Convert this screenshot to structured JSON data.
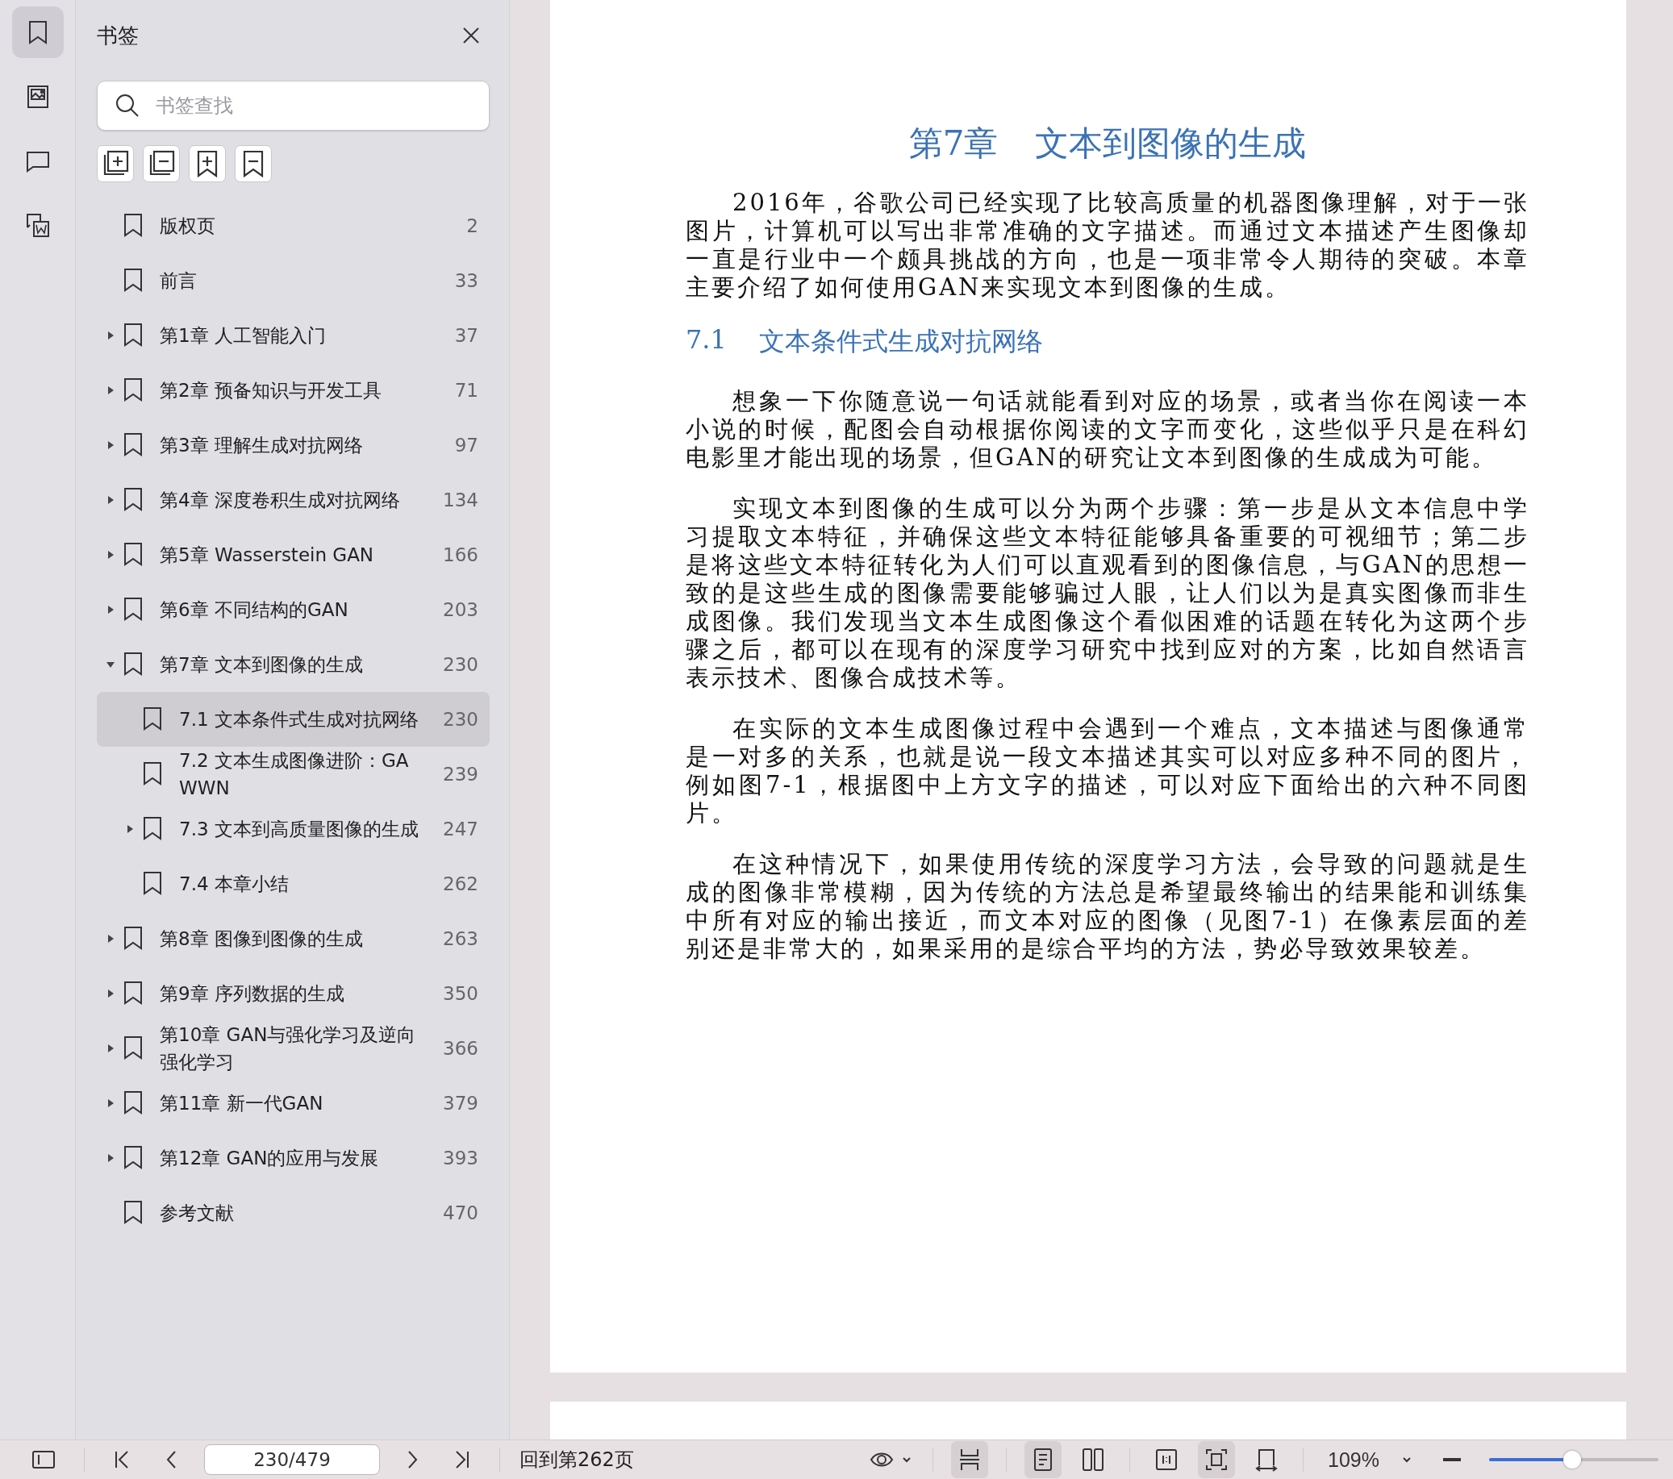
{
  "rail": [
    {
      "kind": "bookmarks",
      "selected": true
    },
    {
      "kind": "images",
      "selected": false
    },
    {
      "kind": "comments",
      "selected": false
    },
    {
      "kind": "convert",
      "selected": false
    }
  ],
  "sidebar": {
    "title": "书签",
    "search": {
      "placeholder": "书签查找"
    },
    "tools": [
      {
        "kind": "expand-all"
      },
      {
        "kind": "collapse-all"
      },
      {
        "kind": "add"
      },
      {
        "kind": "remove"
      }
    ],
    "items": [
      {
        "label": "版权页",
        "page": "2",
        "selected": false
      },
      {
        "label": "前言",
        "page": "33",
        "selected": false
      },
      {
        "label": "第1章 人工智能入门",
        "page": "37",
        "selected": false,
        "expanded": false
      },
      {
        "label": "第2章 预备知识与开发工具",
        "page": "71",
        "selected": false,
        "expanded": false
      },
      {
        "label": "第3章 理解生成对抗网络",
        "page": "97",
        "selected": false,
        "expanded": false
      },
      {
        "label": "第4章 深度卷积生成对抗网络",
        "page": "134",
        "selected": false,
        "expanded": false
      },
      {
        "label": "第5章 Wasserstein GAN",
        "page": "166",
        "selected": false,
        "expanded": false
      },
      {
        "label": "第6章 不同结构的GAN",
        "page": "203",
        "selected": false,
        "expanded": false
      },
      {
        "label": "第7章 文本到图像的生成",
        "page": "230",
        "selected": false,
        "expanded": true,
        "children": [
          {
            "label": "7.1 文本条件式生成对抗网络",
            "page": "230",
            "selected": true
          },
          {
            "label": "7.2 文本生成图像进阶：GAWWN",
            "page": "239",
            "selected": false
          },
          {
            "label": "7.3 文本到高质量图像的生成",
            "page": "247",
            "selected": false,
            "expanded": false
          },
          {
            "label": "7.4 本章小结",
            "page": "262",
            "selected": false
          }
        ]
      },
      {
        "label": "第8章 图像到图像的生成",
        "page": "263",
        "selected": false,
        "expanded": false
      },
      {
        "label": "第9章 序列数据的生成",
        "page": "350",
        "selected": false,
        "expanded": false
      },
      {
        "label": "第10章 GAN与强化学习及逆向强化学习",
        "page": "366",
        "selected": false,
        "expanded": false
      },
      {
        "label": "第11章 新一代GAN",
        "page": "379",
        "selected": false,
        "expanded": false
      },
      {
        "label": "第12章 GAN的应用与发展",
        "page": "393",
        "selected": false,
        "expanded": false
      },
      {
        "label": "参考文献",
        "page": "470",
        "selected": false
      }
    ]
  },
  "document": {
    "chapter_number": "第7章",
    "chapter_title": "文本到图像的生成",
    "blocks": [
      {
        "kind": "paragraph",
        "text": "2016年，谷歌公司已经实现了比较高质量的机器图像理解，对于一张图片，计算机可以写出非常准确的文字描述。而通过文本描述产生图像却一直是行业中一个颇具挑战的方向，也是一项非常令人期待的突破。本章主要介绍了如何使用GAN来实现文本到图像的生成。"
      },
      {
        "kind": "heading",
        "number": "7.1",
        "title": "文本条件式生成对抗网络"
      },
      {
        "kind": "paragraph",
        "text": "想象一下你随意说一句话就能看到对应的场景，或者当你在阅读一本小说的时候，配图会自动根据你阅读的文字而变化，这些似乎只是在科幻电影里才能出现的场景，但GAN的研究让文本到图像的生成成为可能。"
      },
      {
        "kind": "paragraph",
        "text": "实现文本到图像的生成可以分为两个步骤：第一步是从文本信息中学习提取文本特征，并确保这些文本特征能够具备重要的可视细节；第二步是将这些文本特征转化为人们可以直观看到的图像信息，与GAN的思想一致的是这些生成的图像需要能够骗过人眼，让人们以为是真实图像而非生成图像。我们发现当文本生成图像这个看似困难的话题在转化为这两个步骤之后，都可以在现有的深度学习研究中找到应对的方案，比如自然语言表示技术、图像合成技术等。"
      },
      {
        "kind": "paragraph",
        "text": "在实际的文本生成图像过程中会遇到一个难点，文本描述与图像通常是一对多的关系，也就是说一段文本描述其实可以对应多种不同的图片，例如图7-1，根据图中上方文字的描述，可以对应下面给出的六种不同图片。"
      },
      {
        "kind": "paragraph",
        "text": "在这种情况下，如果使用传统的深度学习方法，会导致的问题就是生成的图像非常模糊，因为传统的方法总是希望最终输出的结果能和训练集中所有对应的输出接近，而文本对应的图像（见图7-1）在像素层面的差别还是非常大的，如果采用的是综合平均的方法，势必导致效果较差。"
      }
    ]
  },
  "toolbar": {
    "page_field": "230/479",
    "goto_link": "回到第262页",
    "view_buttons": [
      {
        "kind": "continuous",
        "selected": true
      },
      {
        "kind": "single",
        "selected": true
      },
      {
        "kind": "double",
        "selected": false
      },
      {
        "kind": "actual",
        "selected": false
      },
      {
        "kind": "fit",
        "selected": true
      },
      {
        "kind": "rotate",
        "selected": false
      }
    ],
    "zoom": "109%",
    "zoom_slider": {
      "level": 0.49
    }
  }
}
